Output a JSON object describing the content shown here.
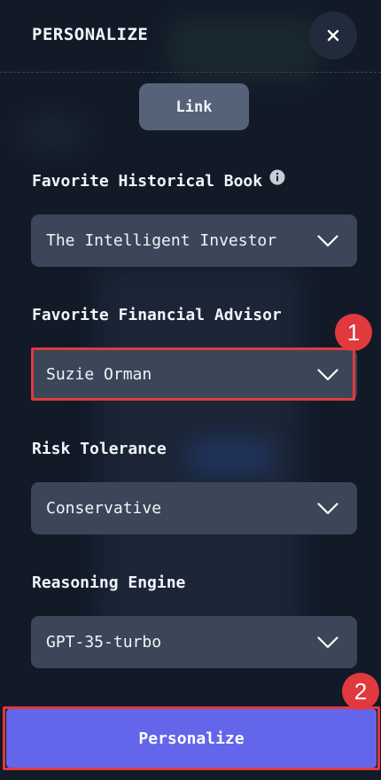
{
  "header": {
    "title": "PERSONALIZE",
    "close_icon": "close-icon"
  },
  "link_button": {
    "label": "Link"
  },
  "fields": [
    {
      "label": "Favorite Historical Book",
      "value": "The Intelligent Investor",
      "has_info_icon": true
    },
    {
      "label": "Favorite Financial Advisor",
      "value": "Suzie Orman"
    },
    {
      "label": "Risk Tolerance",
      "value": "Conservative"
    },
    {
      "label": "Reasoning Engine",
      "value": "GPT-35-turbo"
    }
  ],
  "annotations": [
    {
      "number": "1",
      "target": "Favorite Financial Advisor select"
    },
    {
      "number": "2",
      "target": "Personalize button"
    }
  ],
  "submit_button": {
    "label": "Personalize"
  },
  "colors": {
    "background": "#121a28",
    "select_bg": "#3b4658",
    "link_bg": "#556278",
    "primary": "#6366ea",
    "highlight": "#e0393e"
  }
}
